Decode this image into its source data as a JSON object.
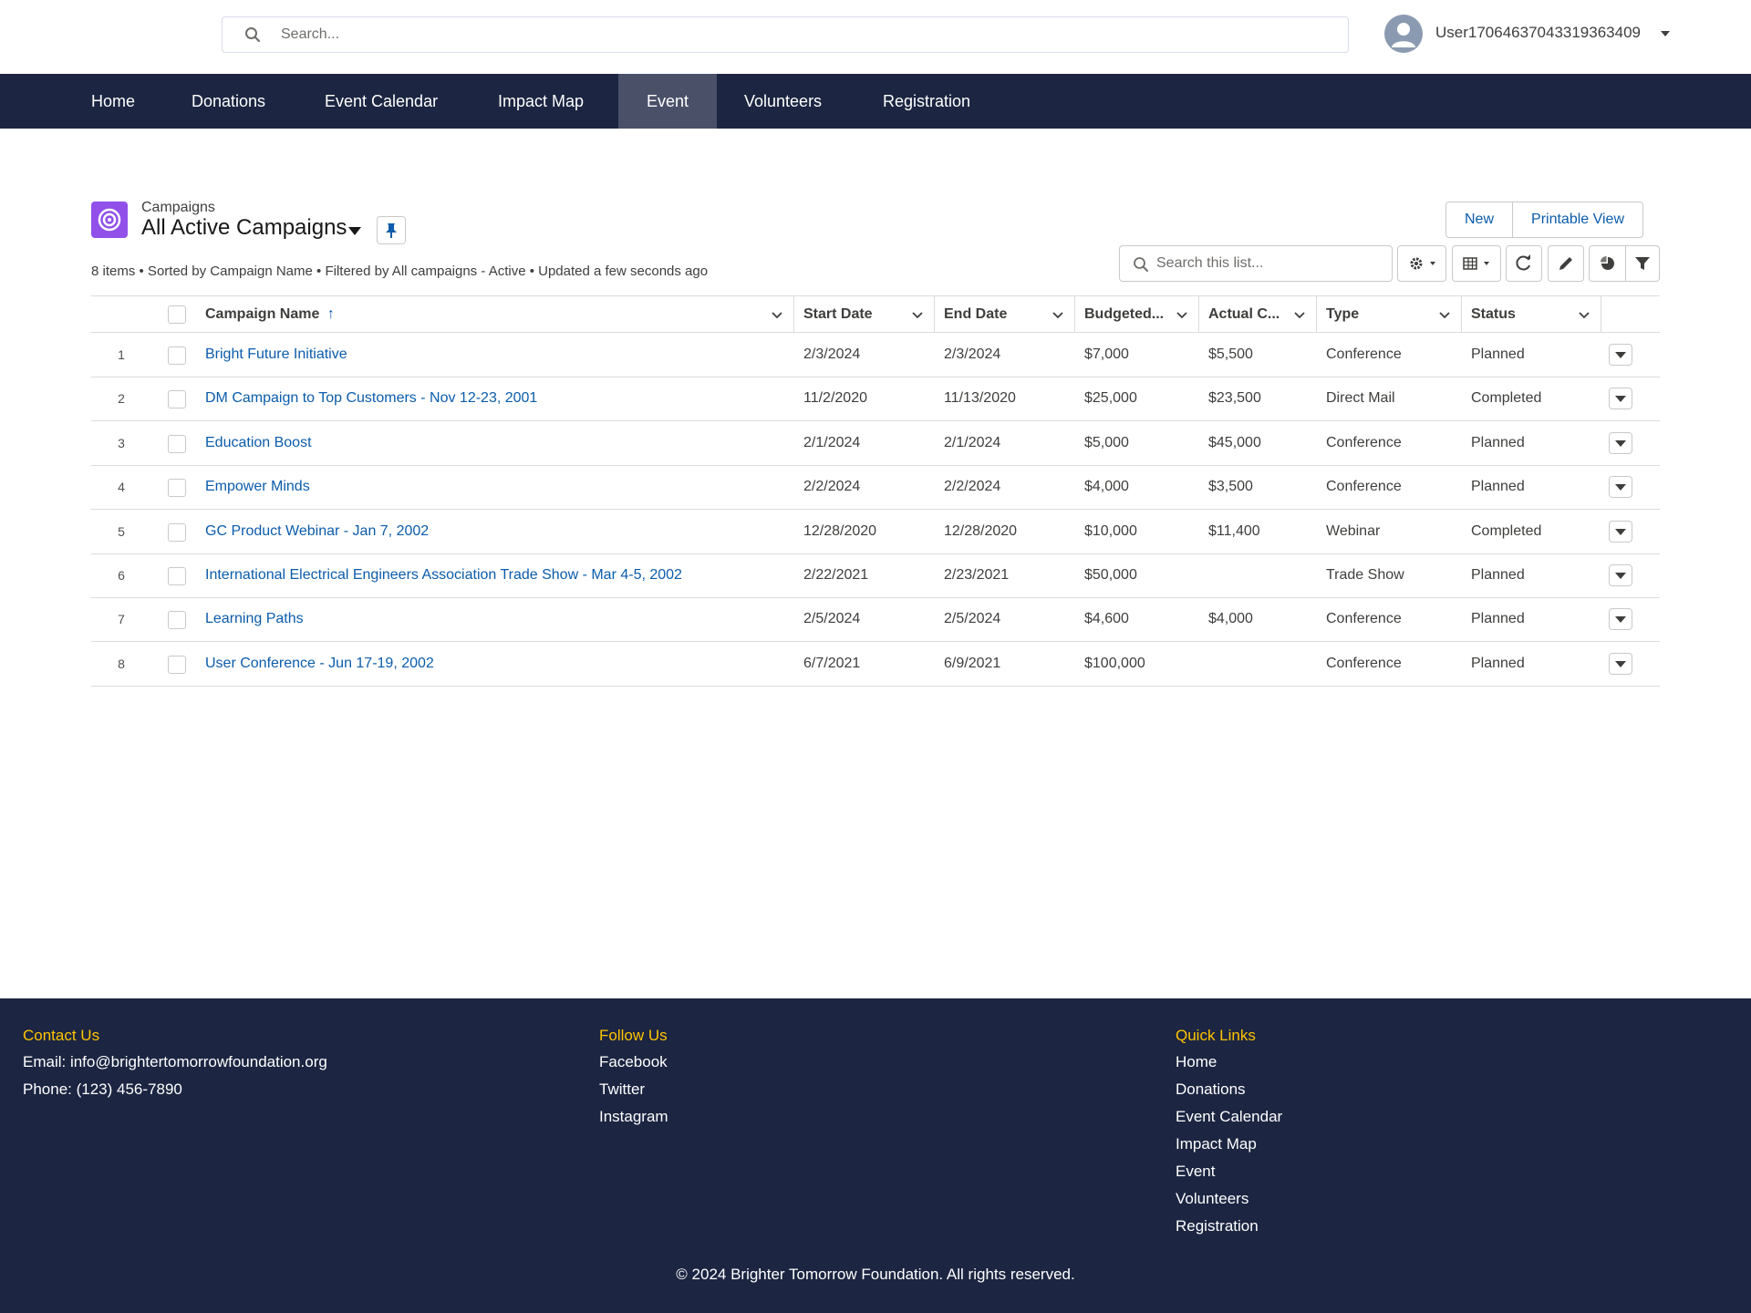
{
  "header": {
    "search_placeholder": "Search...",
    "username": "User17064637043319363409"
  },
  "nav": {
    "items": [
      {
        "label": "Home"
      },
      {
        "label": "Donations"
      },
      {
        "label": "Event Calendar"
      },
      {
        "label": "Impact Map"
      },
      {
        "label": "Event",
        "active": true
      },
      {
        "label": "Volunteers"
      },
      {
        "label": "Registration"
      }
    ]
  },
  "list": {
    "object_label": "Campaigns",
    "title": "All Active Campaigns",
    "meta": "8 items • Sorted by Campaign Name • Filtered by All campaigns - Active • Updated a few seconds ago",
    "buttons": {
      "new": "New",
      "printable": "Printable View"
    },
    "search_placeholder": "Search this list...",
    "columns": {
      "name": "Campaign Name",
      "sort_arrow": "↑",
      "start": "Start Date",
      "end": "End Date",
      "budgeted": "Budgeted...",
      "actual": "Actual C...",
      "type": "Type",
      "status": "Status"
    },
    "rows": [
      {
        "n": "1",
        "name": "Bright Future Initiative",
        "start": "2/3/2024",
        "end": "2/3/2024",
        "budgeted": "$7,000",
        "actual": "$5,500",
        "type": "Conference",
        "status": "Planned"
      },
      {
        "n": "2",
        "name": "DM Campaign to Top Customers - Nov 12-23, 2001",
        "start": "11/2/2020",
        "end": "11/13/2020",
        "budgeted": "$25,000",
        "actual": "$23,500",
        "type": "Direct Mail",
        "status": "Completed"
      },
      {
        "n": "3",
        "name": "Education Boost",
        "start": "2/1/2024",
        "end": "2/1/2024",
        "budgeted": "$5,000",
        "actual": "$45,000",
        "type": "Conference",
        "status": "Planned"
      },
      {
        "n": "4",
        "name": "Empower Minds",
        "start": "2/2/2024",
        "end": "2/2/2024",
        "budgeted": "$4,000",
        "actual": "$3,500",
        "type": "Conference",
        "status": "Planned"
      },
      {
        "n": "5",
        "name": "GC Product Webinar - Jan 7, 2002",
        "start": "12/28/2020",
        "end": "12/28/2020",
        "budgeted": "$10,000",
        "actual": "$11,400",
        "type": "Webinar",
        "status": "Completed"
      },
      {
        "n": "6",
        "name": "International Electrical Engineers Association Trade Show - Mar 4-5, 2002",
        "start": "2/22/2021",
        "end": "2/23/2021",
        "budgeted": "$50,000",
        "actual": "",
        "type": "Trade Show",
        "status": "Planned"
      },
      {
        "n": "7",
        "name": "Learning Paths",
        "start": "2/5/2024",
        "end": "2/5/2024",
        "budgeted": "$4,600",
        "actual": "$4,000",
        "type": "Conference",
        "status": "Planned"
      },
      {
        "n": "8",
        "name": "User Conference - Jun 17-19, 2002",
        "start": "6/7/2021",
        "end": "6/9/2021",
        "budgeted": "$100,000",
        "actual": "",
        "type": "Conference",
        "status": "Planned"
      }
    ]
  },
  "footer": {
    "contact": {
      "heading": "Contact Us",
      "email": "Email: info@brightertomorrowfoundation.org",
      "phone": "Phone: (123) 456-7890"
    },
    "follow": {
      "heading": "Follow Us",
      "items": [
        "Facebook",
        "Twitter",
        "Instagram"
      ]
    },
    "quick": {
      "heading": "Quick Links",
      "items": [
        "Home",
        "Donations",
        "Event Calendar",
        "Impact Map",
        "Event",
        "Volunteers",
        "Registration"
      ]
    },
    "copyright": "© 2024 Brighter Tomorrow Foundation. All rights reserved."
  },
  "colors": {
    "nav_bg": "#1c2541",
    "nav_active": "#4a5068",
    "link": "#0b5cab",
    "footer_heading": "#ffc400",
    "campaign_icon": "#9050e9"
  },
  "icons": {
    "search": "search-icon",
    "avatar": "user-avatar-icon",
    "caret": "caret-down-icon",
    "pin": "pin-icon",
    "settings": "gear-icon",
    "table_view": "table-view-icon",
    "refresh": "refresh-icon",
    "edit": "pencil-icon",
    "chart": "pie-chart-icon",
    "filter": "filter-icon",
    "campaign": "target-icon"
  }
}
